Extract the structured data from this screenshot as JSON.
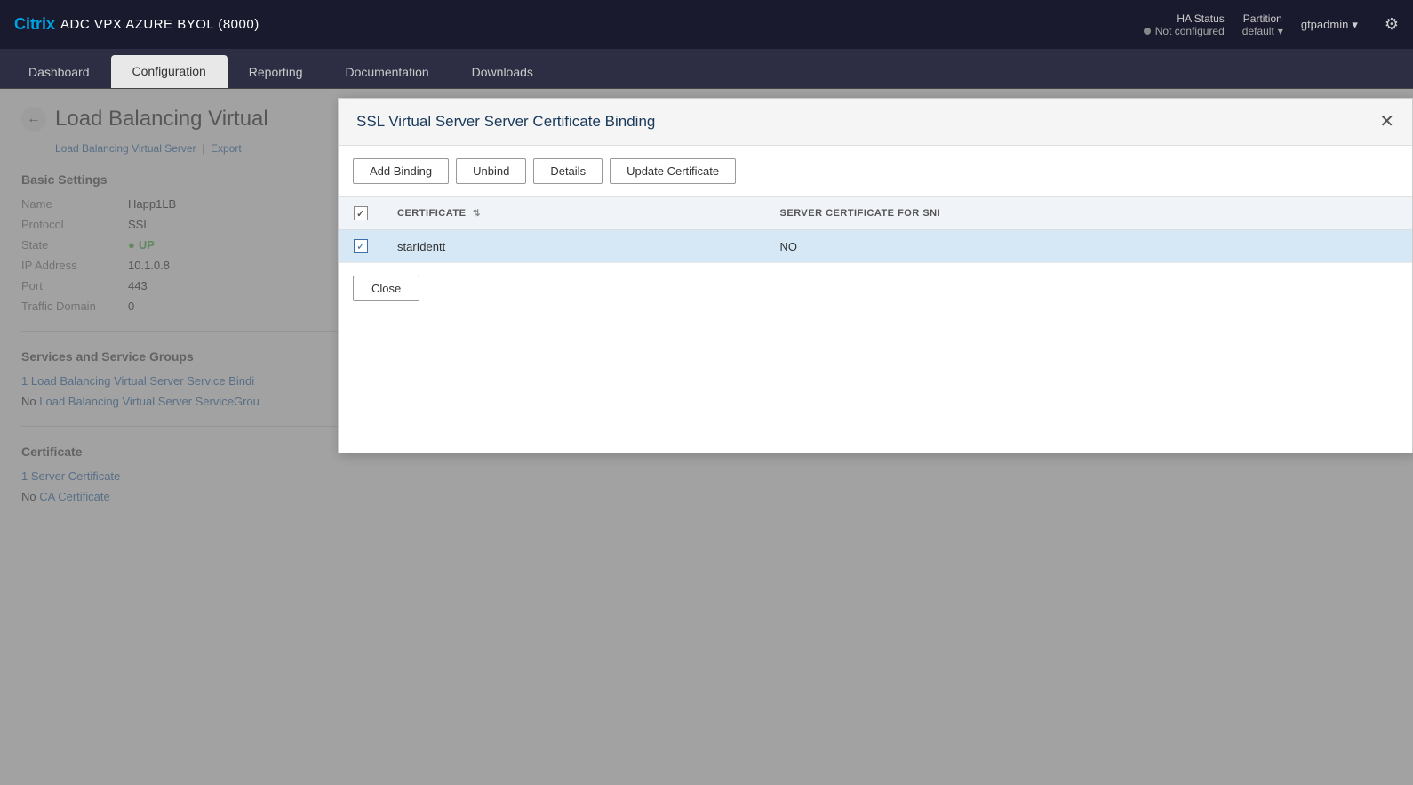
{
  "header": {
    "brand": "Citrix",
    "title": "ADC VPX AZURE BYOL (8000)",
    "ha_status_label": "HA Status",
    "ha_status_value": "Not configured",
    "partition_label": "Partition",
    "partition_value": "default",
    "user": "gtpadmin",
    "gear_label": "Settings"
  },
  "nav": {
    "tabs": [
      {
        "id": "dashboard",
        "label": "Dashboard",
        "active": false
      },
      {
        "id": "configuration",
        "label": "Configuration",
        "active": true
      },
      {
        "id": "reporting",
        "label": "Reporting",
        "active": false
      },
      {
        "id": "documentation",
        "label": "Documentation",
        "active": false
      },
      {
        "id": "downloads",
        "label": "Downloads",
        "active": false
      }
    ]
  },
  "background_page": {
    "title": "Load Balancing Virtual",
    "breadcrumb_main": "Load Balancing Virtual Server",
    "breadcrumb_export": "Export",
    "back_label": "←",
    "basic_settings": {
      "section_title": "Basic Settings",
      "fields": [
        {
          "label": "Name",
          "value": "Happ1LB",
          "type": "normal"
        },
        {
          "label": "Protocol",
          "value": "SSL",
          "type": "normal"
        },
        {
          "label": "State",
          "value": "UP",
          "type": "up"
        },
        {
          "label": "IP Address",
          "value": "10.1.0.8",
          "type": "normal"
        },
        {
          "label": "Port",
          "value": "443",
          "type": "normal"
        },
        {
          "label": "Traffic Domain",
          "value": "0",
          "type": "normal"
        }
      ]
    },
    "services_section": {
      "title": "Services and Service Groups",
      "link1_count": "1",
      "link1_text": "Load Balancing Virtual Server Service Bindi",
      "link2_prefix": "No",
      "link2_text": "Load Balancing Virtual Server ServiceGrou"
    },
    "certificate_section": {
      "title": "Certificate",
      "cert1_count": "1",
      "cert1_text": "Server Certificate",
      "cert2_prefix": "No",
      "cert2_text": "CA Certificate"
    }
  },
  "modal": {
    "title": "SSL Virtual Server Server Certificate Binding",
    "close_label": "✕",
    "toolbar": {
      "add_binding": "Add Binding",
      "unbind": "Unbind",
      "details": "Details",
      "update_certificate": "Update Certificate"
    },
    "table": {
      "columns": [
        {
          "id": "checkbox",
          "label": ""
        },
        {
          "id": "certificate",
          "label": "CERTIFICATE"
        },
        {
          "id": "sni",
          "label": "SERVER CERTIFICATE FOR SNI"
        }
      ],
      "rows": [
        {
          "id": "row1",
          "selected": true,
          "certificate": "starIdentt",
          "sni": "NO"
        }
      ]
    },
    "footer": {
      "close_label": "Close"
    }
  }
}
